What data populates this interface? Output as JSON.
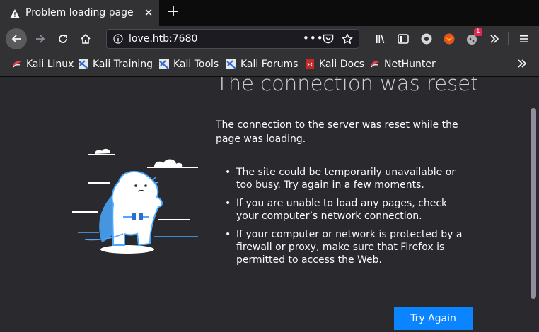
{
  "tab": {
    "title": "Problem loading page",
    "close": "✕",
    "new_tab": "+"
  },
  "urlbar": {
    "url": "love.htb:7680",
    "more": "•••"
  },
  "toolbar": {
    "notification_count": "1"
  },
  "bookmarks": [
    {
      "label": "Kali Linux",
      "icon": "kali-dragon-icon"
    },
    {
      "label": "Kali Training",
      "icon": "kali-training-icon"
    },
    {
      "label": "Kali Tools",
      "icon": "kali-tools-icon"
    },
    {
      "label": "Kali Forums",
      "icon": "kali-forums-icon"
    },
    {
      "label": "Kali Docs",
      "icon": "kali-docs-icon"
    },
    {
      "label": "NetHunter",
      "icon": "nethunter-icon"
    }
  ],
  "error": {
    "title": "The connection was reset",
    "description": "The connection to the server was reset while the page was loading.",
    "bullets": [
      "The site could be temporarily unavailable or too busy. Try again in a few moments.",
      "If you are unable to load any pages, check your computer’s network connection.",
      "If your computer or network is protected by a firewall or proxy, make sure that Firefox is permitted to access the Web."
    ],
    "button": "Try Again"
  },
  "colors": {
    "accent": "#0a84ff",
    "chrome": "#323234",
    "content_bg": "#2a2a2e",
    "badge": "#e22850"
  }
}
